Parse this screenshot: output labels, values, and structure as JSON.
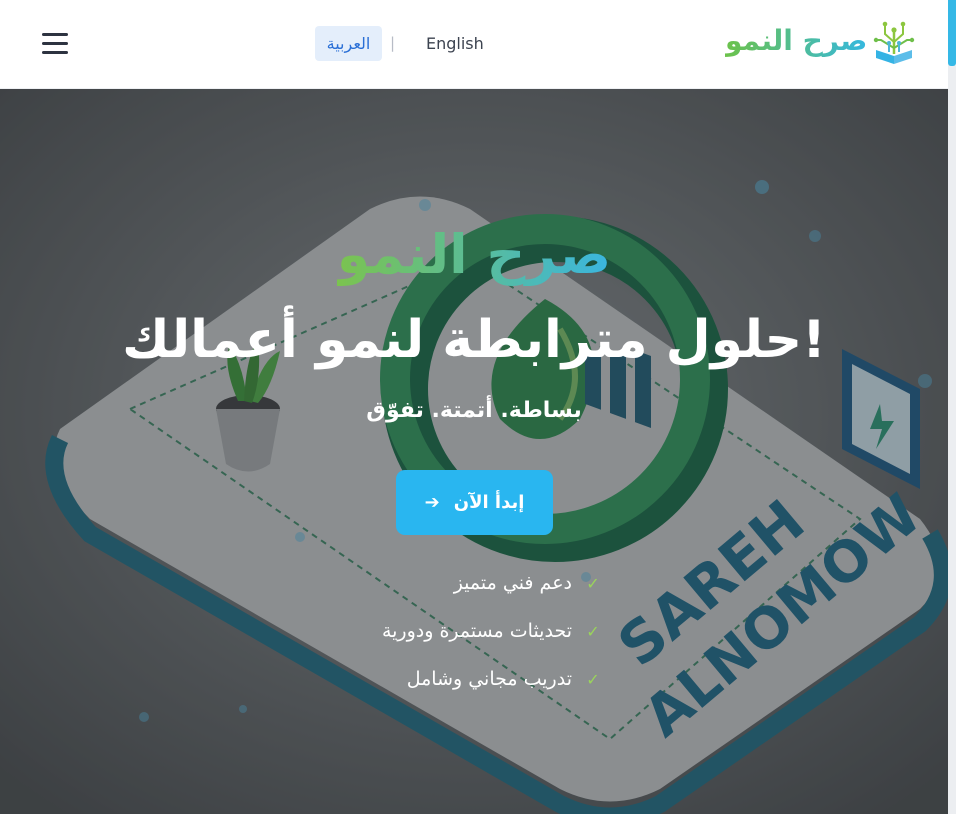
{
  "header": {
    "logo_text": "صرح النمو",
    "lang_arabic": "العربية",
    "lang_separator": "|",
    "lang_english": "English",
    "logo_icon": "circuit-tree-book-icon",
    "menu_icon": "hamburger-icon"
  },
  "hero": {
    "brand_title": "صرح النمو",
    "headline": "حلول مترابطة لنمو أعمالك!",
    "subline": "بساطة. أتمتة. تفوّق",
    "cta_label": "إبدأ الآن",
    "cta_icon": "arrow-right-icon",
    "features": [
      "دعم فني متميز",
      "تحديثات مستمرة ودورية",
      "تدريب مجاني وشامل"
    ],
    "background_image_text": [
      "SAREH",
      "ALNOMOW"
    ]
  },
  "colors": {
    "brand_green": "#7bc34f",
    "brand_blue": "#3ab6e0",
    "cta": "#29b6f0",
    "check": "#9ad45b",
    "lang_active_bg": "#e4eefb"
  }
}
